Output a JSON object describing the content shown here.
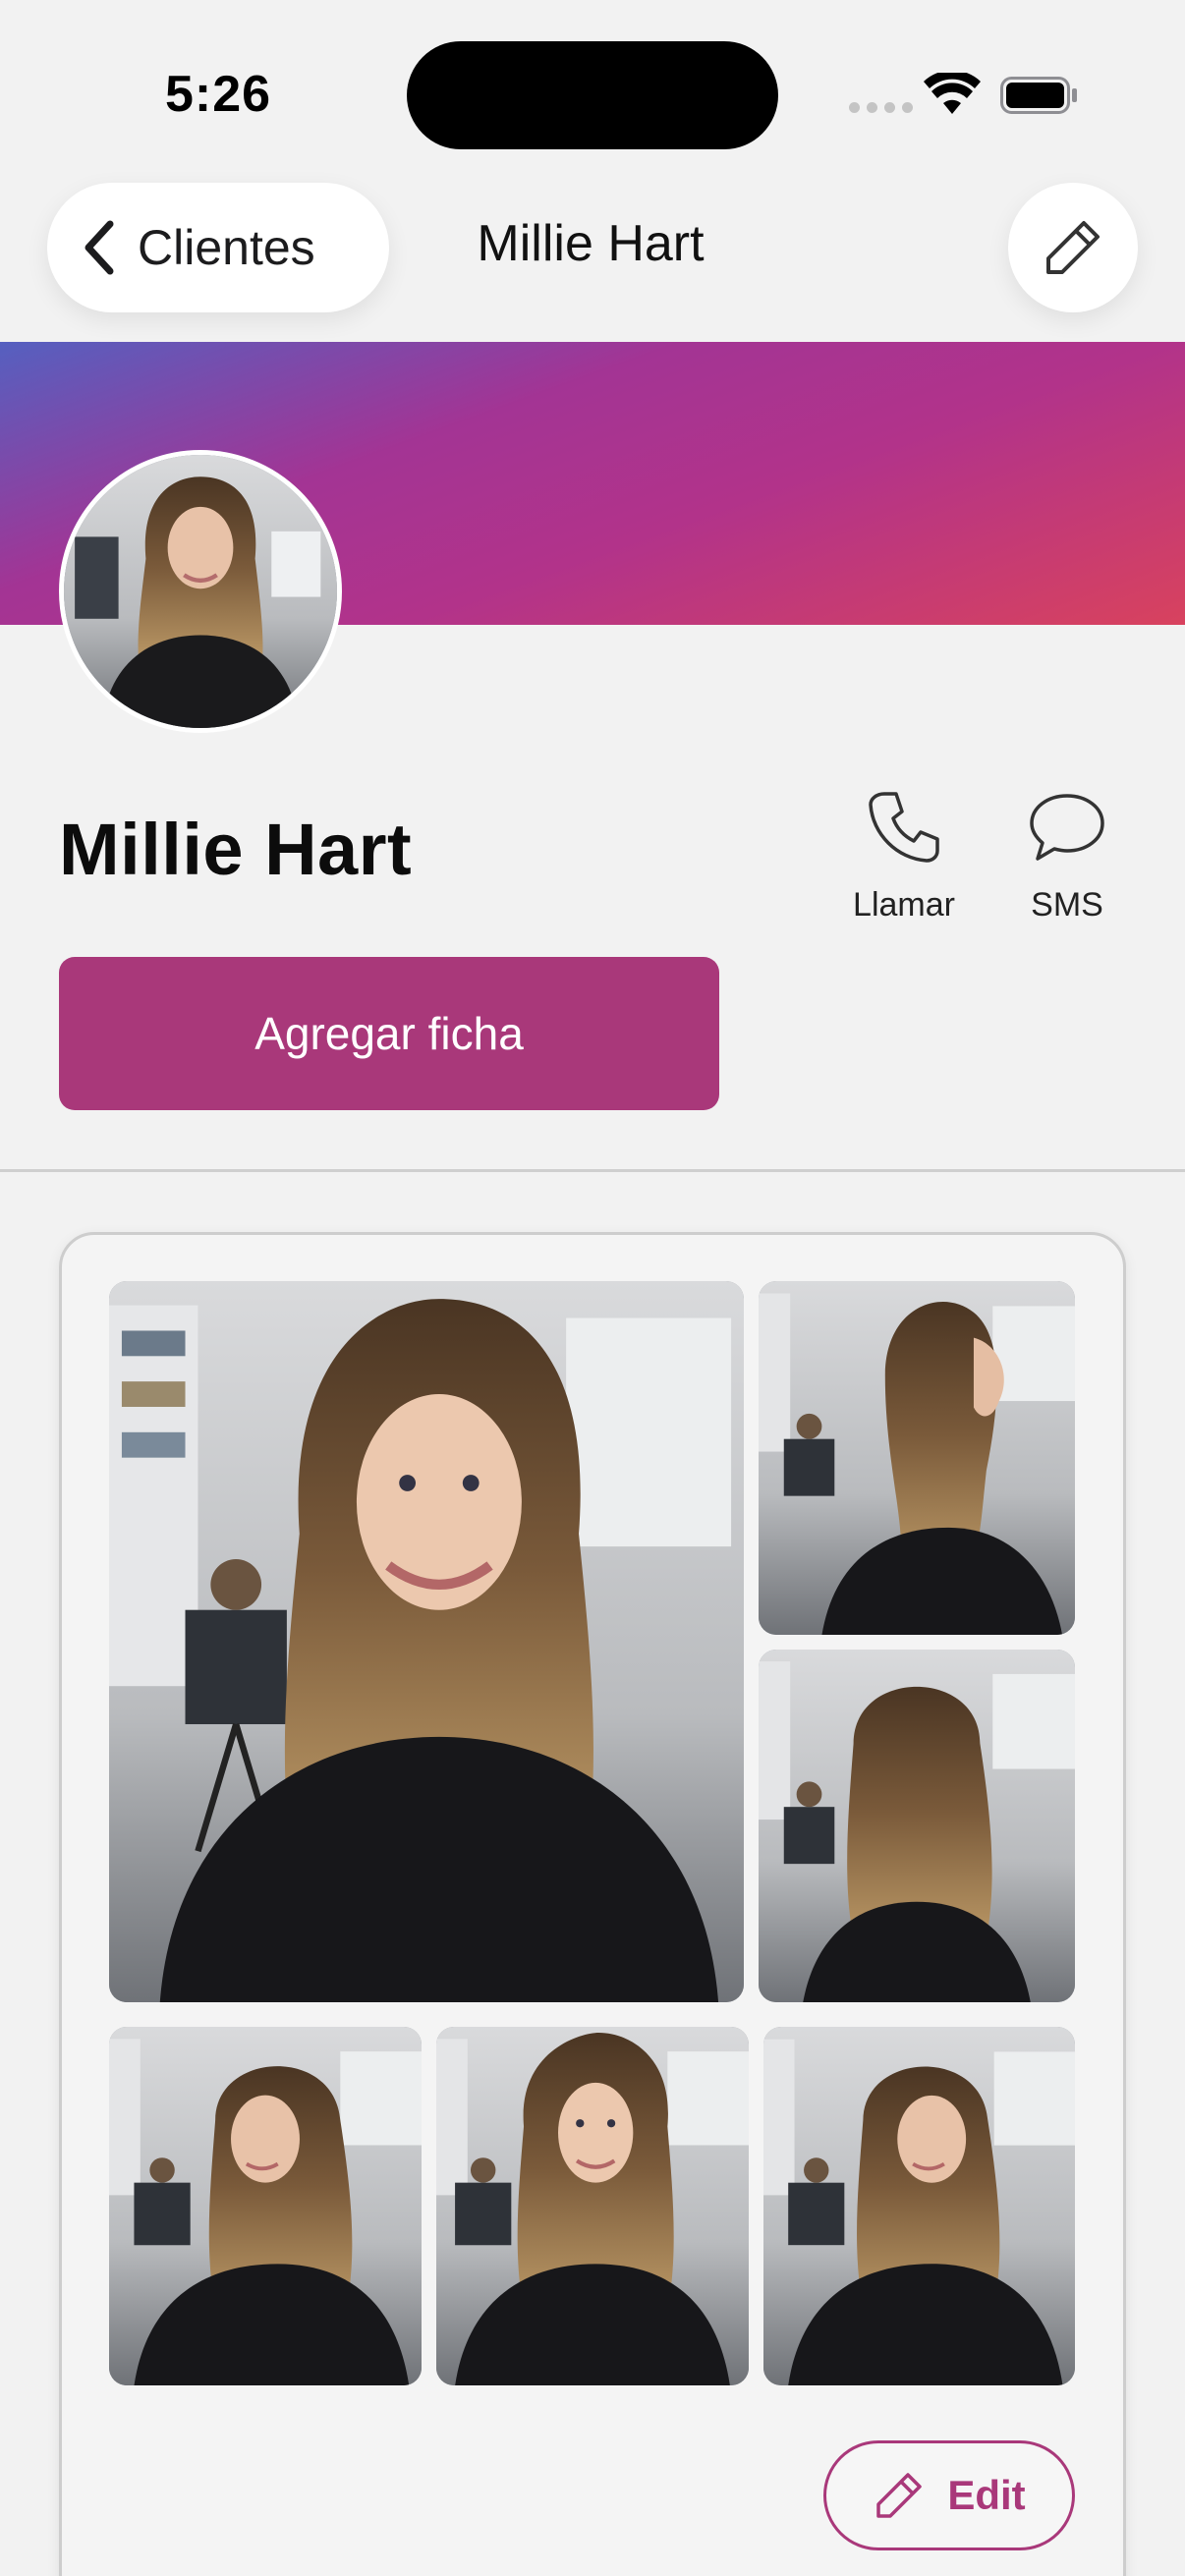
{
  "status_bar": {
    "time": "5:26"
  },
  "nav": {
    "back_label": "Clientes",
    "title": "Millie Hart",
    "edit_icon": "pencil-icon"
  },
  "banner": {
    "gradient_colors": [
      "#5560c0",
      "#a33494",
      "#d8425e"
    ]
  },
  "client": {
    "name": "Millie Hart"
  },
  "actions": {
    "call_label": "Llamar",
    "sms_label": "SMS"
  },
  "add_button": {
    "label": "Agregar ficha",
    "color": "#a9387a"
  },
  "gallery": {
    "photos": [
      "front-smile",
      "side-profile",
      "back-view",
      "looking-down-left",
      "front-portrait",
      "looking-down-right"
    ],
    "edit_label": "Edit"
  }
}
